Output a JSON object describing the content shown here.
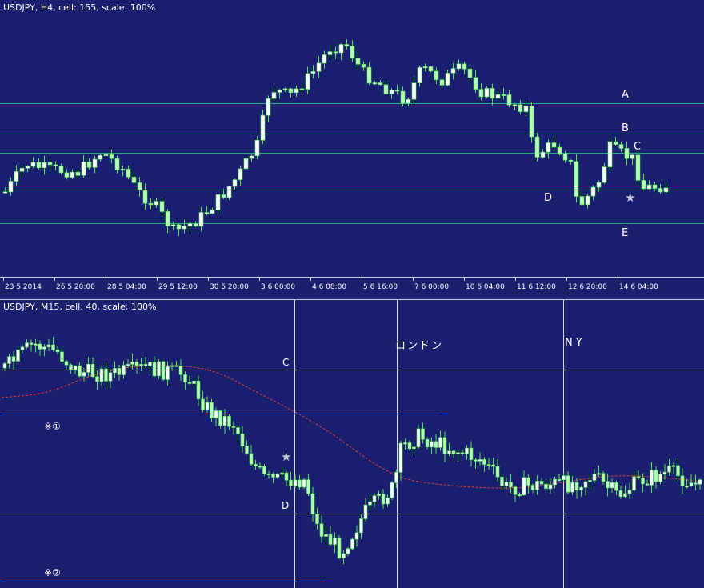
{
  "top_chart": {
    "title": "USDJPY, H4, cell: 155, scale: 100%",
    "x_ticks": [
      "23 5 2014",
      "26 5 20:00",
      "28 5 04:00",
      "29 5 12:00",
      "30 5 20:00",
      "3 6 00:00",
      "4 6 08:00",
      "5 6 16:00",
      "7 6 00:00",
      "10 6 04:00",
      "11 6 12:00",
      "12 6 20:00",
      "14 6 04:00"
    ],
    "level_labels": [
      "A",
      "B",
      "C",
      "D",
      "E"
    ],
    "star": "★"
  },
  "bottom_chart": {
    "title": "USDJPY, M15, cell: 40, scale: 100%",
    "session_labels": [
      "ロンドン",
      "NY"
    ],
    "level_labels": [
      "C",
      "D"
    ],
    "notes": [
      "※①",
      "※②"
    ],
    "star": "★"
  },
  "chart_data": [
    {
      "type": "candlestick",
      "title": "USDJPY, H4, cell: 155, scale: 100%",
      "x_ticks": [
        "23 5 2014",
        "26 5 20:00",
        "28 5 04:00",
        "29 5 12:00",
        "30 5 20:00",
        "3 6 00:00",
        "4 6 08:00",
        "5 6 16:00",
        "7 6 00:00",
        "10 6 04:00",
        "11 6 12:00",
        "12 6 20:00",
        "14 6 04:00"
      ],
      "horizontal_levels": [
        "A",
        "B",
        "C",
        "D",
        "E"
      ],
      "grid": false,
      "candle_count": 120
    },
    {
      "type": "candlestick",
      "title": "USDJPY, M15, cell: 40, scale: 100%",
      "vertical_markers": [
        "ロンドン",
        "NY"
      ],
      "horizontal_levels": [
        "C",
        "D"
      ],
      "annotations": [
        "※①",
        "※②",
        "★"
      ],
      "moving_average": "red dashed",
      "grid": false,
      "candle_count": 160
    }
  ],
  "colors": {
    "background": "#1b1f70",
    "bull_body": "#ffffff",
    "bear_body": "#b4ffb4",
    "wick": "#50e650",
    "top_levels": "#2aa88a",
    "bottom_levels": "#d8d8e8",
    "red_lines": "#e03a1e",
    "ma": "#d8403a",
    "text": "#ffffff"
  }
}
